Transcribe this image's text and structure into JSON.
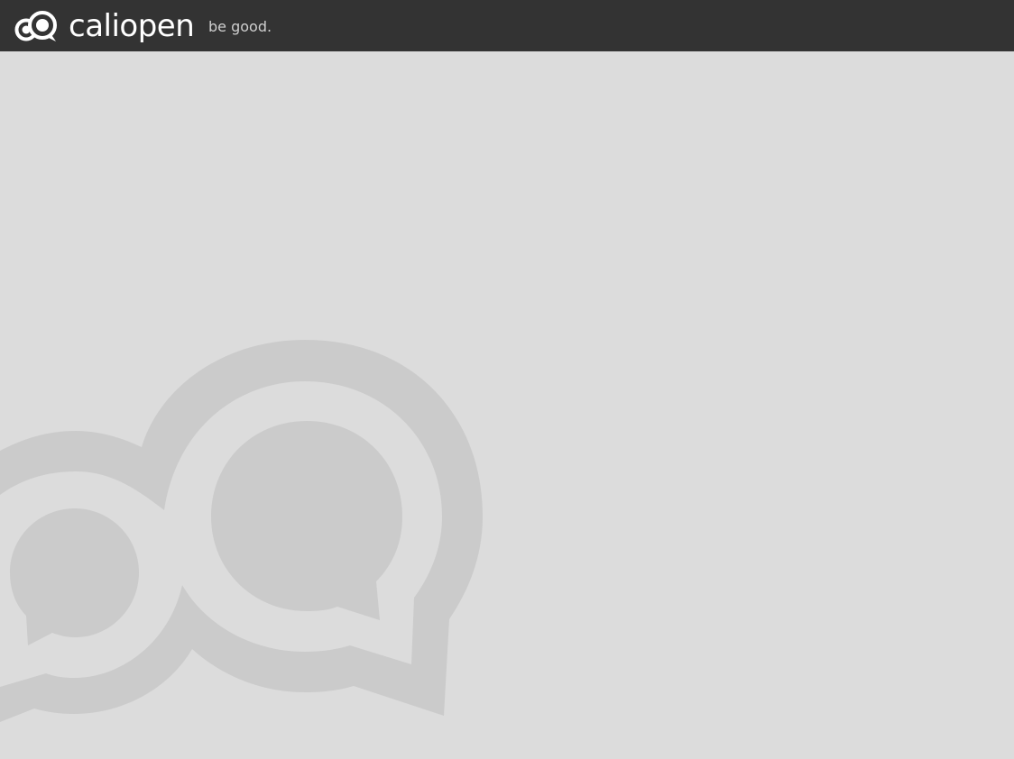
{
  "header": {
    "brand_name": "caliopen",
    "tagline": "be good."
  },
  "icons": {
    "brand": "caliopen-logo-icon",
    "background": "caliopen-watermark-logo"
  },
  "colors": {
    "header_bg": "#333333",
    "page_bg": "#dcdcdc",
    "watermark": "#cbcbcb",
    "brand_text": "#ffffff"
  }
}
